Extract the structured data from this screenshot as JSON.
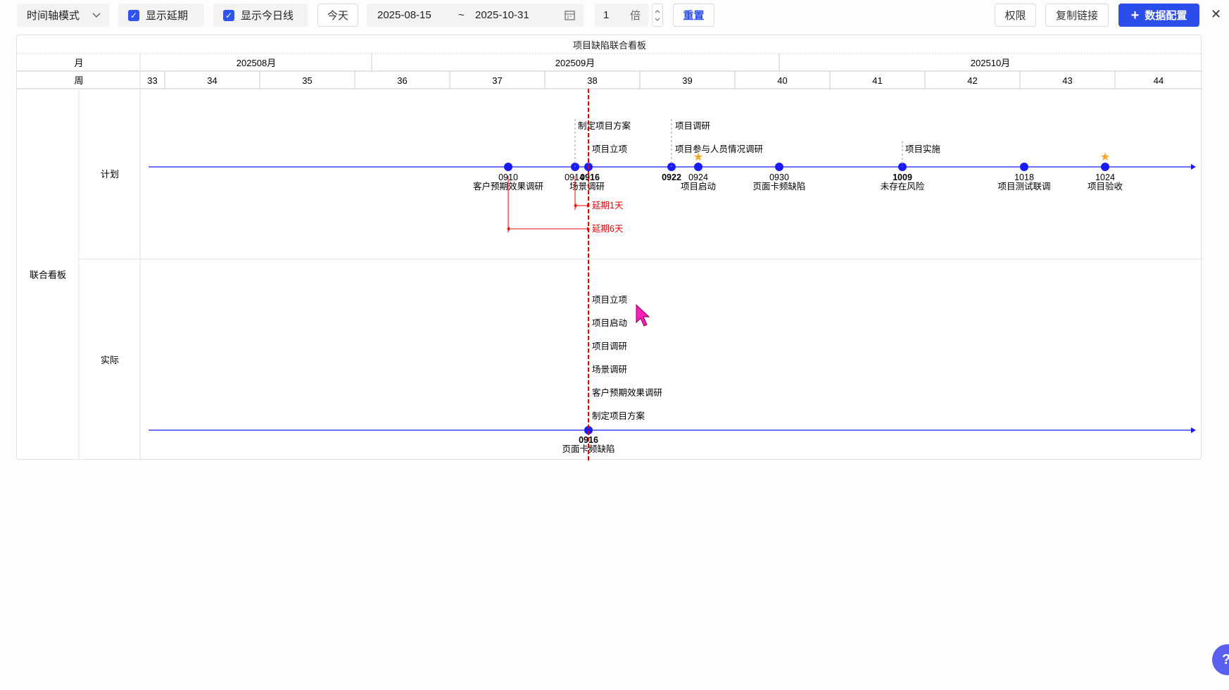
{
  "toolbar": {
    "mode_select": "时间轴模式",
    "show_delay": "显示延期",
    "show_today": "显示今日线",
    "today_btn": "今天",
    "start_date": "2025-08-15",
    "tilde": "~",
    "end_date": "2025-10-31",
    "zoom_value": "1",
    "zoom_unit": "倍",
    "reset": "重置",
    "permission": "权限",
    "copy_link": "复制链接",
    "data_config": "数据配置",
    "close_symbol": "✕"
  },
  "board": {
    "title": "项目缺陷联合看板",
    "row_label_month": "月",
    "row_label_week": "周",
    "months": [
      "202508月",
      "202509月",
      "202510月"
    ],
    "weeks": [
      "33",
      "34",
      "35",
      "36",
      "37",
      "38",
      "39",
      "40",
      "41",
      "42",
      "43",
      "44"
    ],
    "group_label": "联合看板",
    "lanes": [
      "计划",
      "实际"
    ]
  },
  "plan": {
    "milestones": [
      {
        "date": "0910",
        "label": "客户预期效果调研",
        "star": false,
        "color": "#1a1aff"
      },
      {
        "date": "0914",
        "label": "场景调研",
        "star": false,
        "color": "#1a1aff"
      },
      {
        "date": "0916",
        "label": "",
        "star": false,
        "color": "#1a1aff"
      },
      {
        "date": "0922",
        "label": "",
        "star": false,
        "color": "#1a1aff"
      },
      {
        "date": "0924",
        "label": "项目启动",
        "star": true,
        "color": "#1a1aff"
      },
      {
        "date": "0930",
        "label": "页面卡频缺陷",
        "star": false,
        "color": "#1a1aff"
      },
      {
        "date": "1009",
        "label": "未存在风险",
        "star": false,
        "color": "#1a1aff"
      },
      {
        "date": "1018",
        "label": "项目测试联调",
        "star": false,
        "color": "#1a1aff"
      },
      {
        "date": "1024",
        "label": "项目验收",
        "star": true,
        "color": "#1a1aff"
      }
    ],
    "upper_labels": [
      "制定项目方案",
      "项目立项",
      "项目调研",
      "项目参与人员情况调研",
      "项目实施"
    ],
    "delays": [
      "延期1天",
      "延期6天"
    ]
  },
  "actual": {
    "stack_labels": [
      "项目立项",
      "项目启动",
      "项目调研",
      "场景调研",
      "客户预期效果调研",
      "制定项目方案"
    ],
    "milestone": {
      "date": "0916",
      "label": "页面卡频缺陷"
    }
  },
  "colors": {
    "accent": "#2b4eea",
    "timeline": "#1a1aff",
    "today": "#e60000",
    "star": "#f5a623"
  },
  "icons": [
    "chevron-down-icon",
    "checkbox-checked-icon",
    "calendar-icon",
    "spinner-icon",
    "plus-icon",
    "close-icon",
    "help-icon",
    "cursor-icon",
    "star-icon"
  ]
}
